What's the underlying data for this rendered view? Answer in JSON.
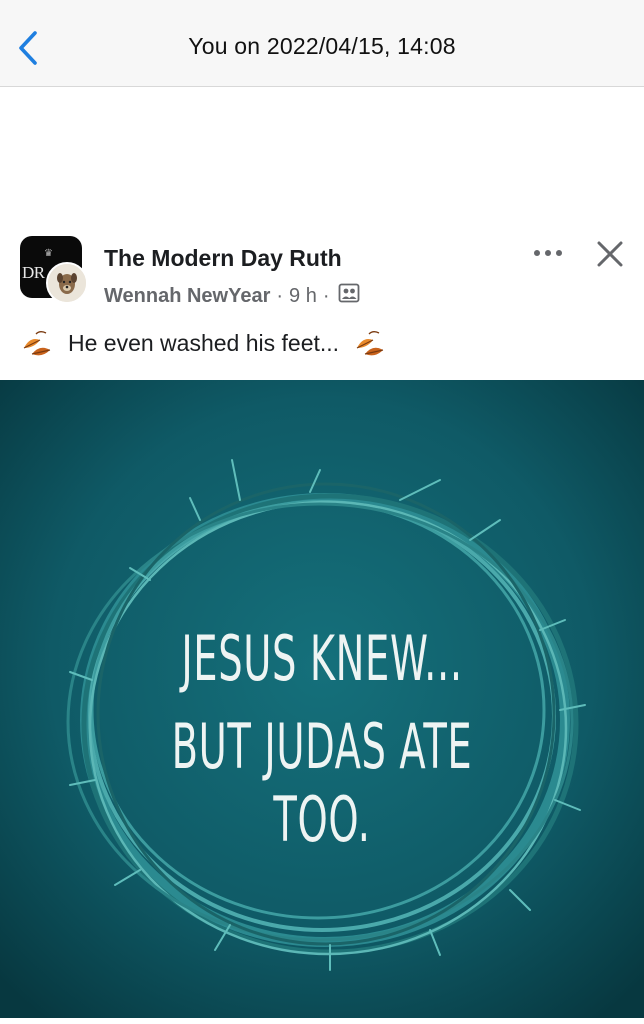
{
  "header": {
    "title": "You on 2022/04/15, 14:08",
    "back_icon": "chevron-left-icon",
    "accent_color": "#1f7fe0"
  },
  "post": {
    "page_name": "The Modern Day Ruth",
    "author": "Wennah NewYear",
    "time": "9 h",
    "separator": "·",
    "audience_icon": "friends-audience-icon",
    "page_avatar_text": "DR",
    "caption": "He even washed his feet...",
    "caption_emoji": "fallen-leaf-icon",
    "image": {
      "line1": "JESUS KNEW...",
      "line2": "BUT JUDAS ATE TOO.",
      "background_color": "#0f5a66"
    }
  }
}
